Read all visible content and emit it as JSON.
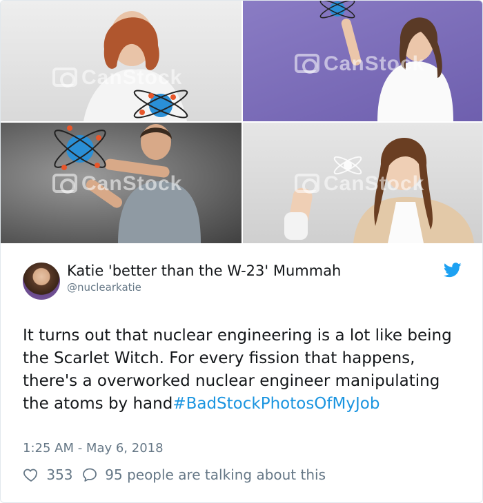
{
  "images": {
    "watermark": "CanStock"
  },
  "tweet": {
    "author_name": "Katie 'better than the W-23' Mummah",
    "author_handle": "@nuclearkatie",
    "text": "It turns out that nuclear engineering is a lot like being the Scarlet Witch. For every fission that happens, there's a overworked nuclear engineer manipulating the atoms by hand",
    "hashtag": "#BadStockPhotosOfMyJob",
    "timestamp": "1:25 AM - May 6, 2018",
    "likes": "353",
    "replies_text": "95 people are talking about this"
  },
  "colors": {
    "twitter_blue": "#1da1f2",
    "hashtag": "#1b95e0",
    "secondary_text": "#657786",
    "primary_text": "#14171a"
  },
  "icons": [
    "heart-icon",
    "reply-icon",
    "twitter-bird-icon"
  ]
}
